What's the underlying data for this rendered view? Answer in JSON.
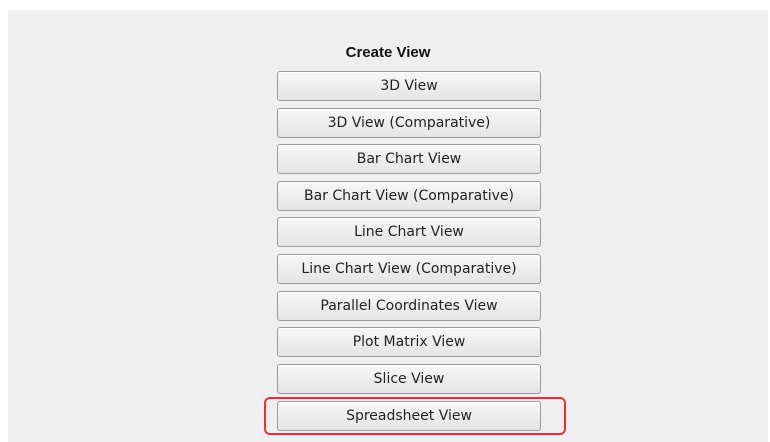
{
  "dialog": {
    "heading": "Create View",
    "buttons": [
      "3D View",
      "3D View (Comparative)",
      "Bar Chart View",
      "Bar Chart View (Comparative)",
      "Line Chart View",
      "Line Chart View (Comparative)",
      "Parallel Coordinates View",
      "Plot Matrix View",
      "Slice View",
      "Spreadsheet View"
    ],
    "highlighted_button": "Spreadsheet View",
    "highlight_color": "#e8303a"
  }
}
